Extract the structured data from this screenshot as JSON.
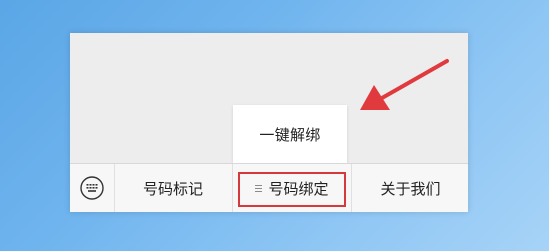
{
  "popup": {
    "item_label": "一键解绑"
  },
  "bottom_menu": {
    "keyboard_icon": "keyboard-icon",
    "tabs": [
      {
        "label": "号码标记"
      },
      {
        "label": "号码绑定",
        "icon": "menu-lines-icon",
        "highlighted": true
      },
      {
        "label": "关于我们"
      }
    ]
  },
  "annotation": {
    "color": "#e0393e"
  }
}
